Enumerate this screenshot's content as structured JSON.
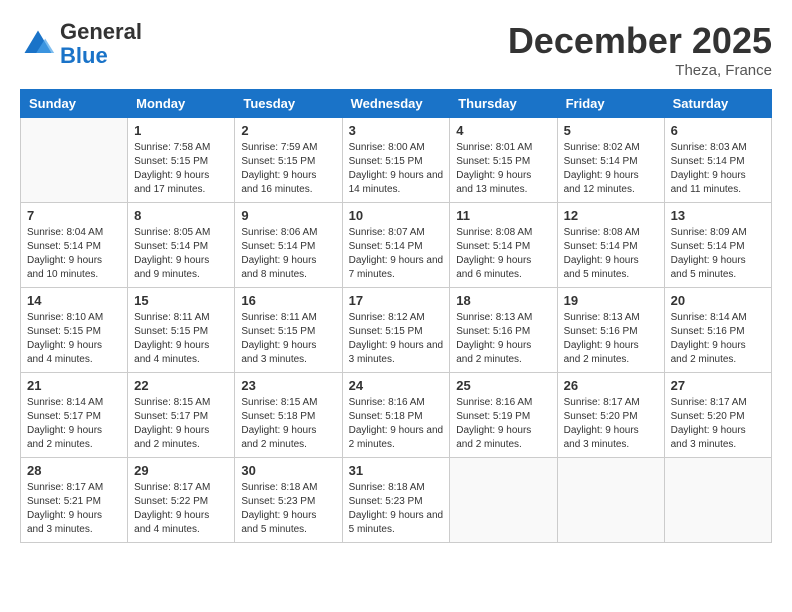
{
  "header": {
    "logo_general": "General",
    "logo_blue": "Blue",
    "month": "December 2025",
    "location": "Theza, France"
  },
  "weekdays": [
    "Sunday",
    "Monday",
    "Tuesday",
    "Wednesday",
    "Thursday",
    "Friday",
    "Saturday"
  ],
  "weeks": [
    [
      {
        "day": null
      },
      {
        "day": 1,
        "sunrise": "7:58 AM",
        "sunset": "5:15 PM",
        "daylight": "9 hours and 17 minutes."
      },
      {
        "day": 2,
        "sunrise": "7:59 AM",
        "sunset": "5:15 PM",
        "daylight": "9 hours and 16 minutes."
      },
      {
        "day": 3,
        "sunrise": "8:00 AM",
        "sunset": "5:15 PM",
        "daylight": "9 hours and 14 minutes."
      },
      {
        "day": 4,
        "sunrise": "8:01 AM",
        "sunset": "5:15 PM",
        "daylight": "9 hours and 13 minutes."
      },
      {
        "day": 5,
        "sunrise": "8:02 AM",
        "sunset": "5:14 PM",
        "daylight": "9 hours and 12 minutes."
      },
      {
        "day": 6,
        "sunrise": "8:03 AM",
        "sunset": "5:14 PM",
        "daylight": "9 hours and 11 minutes."
      }
    ],
    [
      {
        "day": 7,
        "sunrise": "8:04 AM",
        "sunset": "5:14 PM",
        "daylight": "9 hours and 10 minutes."
      },
      {
        "day": 8,
        "sunrise": "8:05 AM",
        "sunset": "5:14 PM",
        "daylight": "9 hours and 9 minutes."
      },
      {
        "day": 9,
        "sunrise": "8:06 AM",
        "sunset": "5:14 PM",
        "daylight": "9 hours and 8 minutes."
      },
      {
        "day": 10,
        "sunrise": "8:07 AM",
        "sunset": "5:14 PM",
        "daylight": "9 hours and 7 minutes."
      },
      {
        "day": 11,
        "sunrise": "8:08 AM",
        "sunset": "5:14 PM",
        "daylight": "9 hours and 6 minutes."
      },
      {
        "day": 12,
        "sunrise": "8:08 AM",
        "sunset": "5:14 PM",
        "daylight": "9 hours and 5 minutes."
      },
      {
        "day": 13,
        "sunrise": "8:09 AM",
        "sunset": "5:14 PM",
        "daylight": "9 hours and 5 minutes."
      }
    ],
    [
      {
        "day": 14,
        "sunrise": "8:10 AM",
        "sunset": "5:15 PM",
        "daylight": "9 hours and 4 minutes."
      },
      {
        "day": 15,
        "sunrise": "8:11 AM",
        "sunset": "5:15 PM",
        "daylight": "9 hours and 4 minutes."
      },
      {
        "day": 16,
        "sunrise": "8:11 AM",
        "sunset": "5:15 PM",
        "daylight": "9 hours and 3 minutes."
      },
      {
        "day": 17,
        "sunrise": "8:12 AM",
        "sunset": "5:15 PM",
        "daylight": "9 hours and 3 minutes."
      },
      {
        "day": 18,
        "sunrise": "8:13 AM",
        "sunset": "5:16 PM",
        "daylight": "9 hours and 2 minutes."
      },
      {
        "day": 19,
        "sunrise": "8:13 AM",
        "sunset": "5:16 PM",
        "daylight": "9 hours and 2 minutes."
      },
      {
        "day": 20,
        "sunrise": "8:14 AM",
        "sunset": "5:16 PM",
        "daylight": "9 hours and 2 minutes."
      }
    ],
    [
      {
        "day": 21,
        "sunrise": "8:14 AM",
        "sunset": "5:17 PM",
        "daylight": "9 hours and 2 minutes."
      },
      {
        "day": 22,
        "sunrise": "8:15 AM",
        "sunset": "5:17 PM",
        "daylight": "9 hours and 2 minutes."
      },
      {
        "day": 23,
        "sunrise": "8:15 AM",
        "sunset": "5:18 PM",
        "daylight": "9 hours and 2 minutes."
      },
      {
        "day": 24,
        "sunrise": "8:16 AM",
        "sunset": "5:18 PM",
        "daylight": "9 hours and 2 minutes."
      },
      {
        "day": 25,
        "sunrise": "8:16 AM",
        "sunset": "5:19 PM",
        "daylight": "9 hours and 2 minutes."
      },
      {
        "day": 26,
        "sunrise": "8:17 AM",
        "sunset": "5:20 PM",
        "daylight": "9 hours and 3 minutes."
      },
      {
        "day": 27,
        "sunrise": "8:17 AM",
        "sunset": "5:20 PM",
        "daylight": "9 hours and 3 minutes."
      }
    ],
    [
      {
        "day": 28,
        "sunrise": "8:17 AM",
        "sunset": "5:21 PM",
        "daylight": "9 hours and 3 minutes."
      },
      {
        "day": 29,
        "sunrise": "8:17 AM",
        "sunset": "5:22 PM",
        "daylight": "9 hours and 4 minutes."
      },
      {
        "day": 30,
        "sunrise": "8:18 AM",
        "sunset": "5:23 PM",
        "daylight": "9 hours and 5 minutes."
      },
      {
        "day": 31,
        "sunrise": "8:18 AM",
        "sunset": "5:23 PM",
        "daylight": "9 hours and 5 minutes."
      },
      {
        "day": null
      },
      {
        "day": null
      },
      {
        "day": null
      }
    ]
  ]
}
